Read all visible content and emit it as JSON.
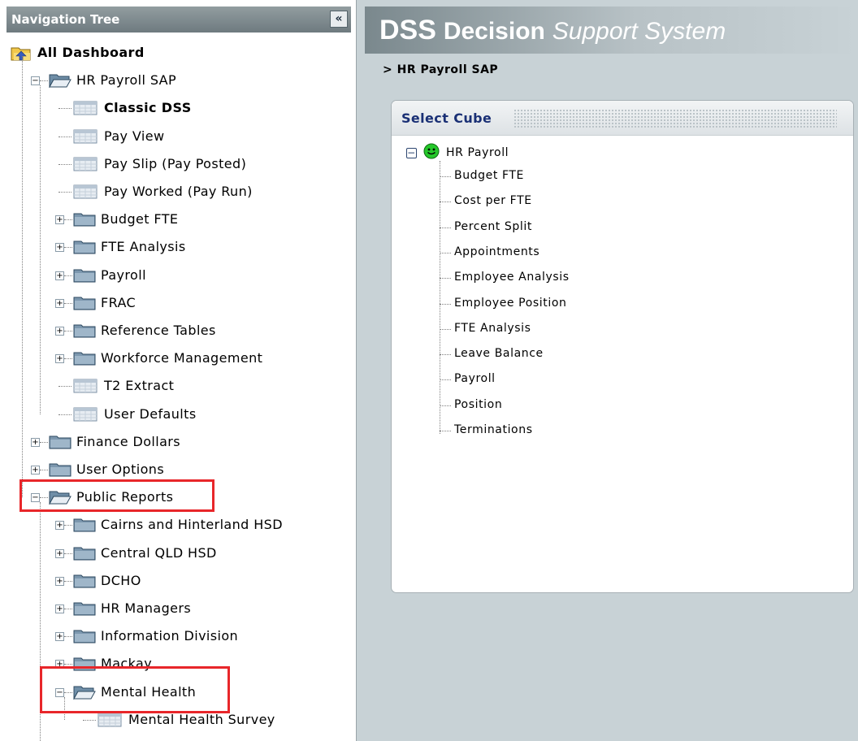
{
  "nav": {
    "title": "Navigation Tree",
    "collapse_glyph": "«",
    "items": [
      {
        "label": "All Dashboard",
        "icon": "dashboard-icon",
        "depth": 0,
        "toggle": "none",
        "bold": true
      },
      {
        "label": "HR Payroll SAP",
        "icon": "folder-open-icon",
        "depth": 1,
        "toggle": "minus",
        "bold": false
      },
      {
        "label": "Classic DSS",
        "icon": "report-icon",
        "depth": 2,
        "toggle": "none",
        "bold": true
      },
      {
        "label": "Pay View",
        "icon": "report-icon",
        "depth": 2,
        "toggle": "none",
        "bold": false
      },
      {
        "label": "Pay Slip (Pay Posted)",
        "icon": "report-icon",
        "depth": 2,
        "toggle": "none",
        "bold": false
      },
      {
        "label": "Pay Worked (Pay Run)",
        "icon": "report-icon",
        "depth": 2,
        "toggle": "none",
        "bold": false
      },
      {
        "label": "Budget FTE",
        "icon": "folder-icon",
        "depth": 2,
        "toggle": "plus",
        "bold": false
      },
      {
        "label": "FTE Analysis",
        "icon": "folder-icon",
        "depth": 2,
        "toggle": "plus",
        "bold": false
      },
      {
        "label": "Payroll",
        "icon": "folder-icon",
        "depth": 2,
        "toggle": "plus",
        "bold": false
      },
      {
        "label": "FRAC",
        "icon": "folder-icon",
        "depth": 2,
        "toggle": "plus",
        "bold": false
      },
      {
        "label": "Reference Tables",
        "icon": "folder-icon",
        "depth": 2,
        "toggle": "plus",
        "bold": false
      },
      {
        "label": "Workforce Management",
        "icon": "folder-icon",
        "depth": 2,
        "toggle": "plus",
        "bold": false
      },
      {
        "label": "T2 Extract",
        "icon": "report-icon",
        "depth": 2,
        "toggle": "none",
        "bold": false
      },
      {
        "label": "User Defaults",
        "icon": "report-icon",
        "depth": 2,
        "toggle": "none",
        "bold": false
      },
      {
        "label": "Finance Dollars",
        "icon": "folder-icon",
        "depth": 1,
        "toggle": "plus",
        "bold": false
      },
      {
        "label": "User Options",
        "icon": "folder-icon",
        "depth": 1,
        "toggle": "plus",
        "bold": false
      },
      {
        "label": "Public Reports",
        "icon": "folder-open-icon",
        "depth": 1,
        "toggle": "minus",
        "bold": false
      },
      {
        "label": "Cairns and Hinterland HSD",
        "icon": "folder-icon",
        "depth": 2,
        "toggle": "plus",
        "bold": false
      },
      {
        "label": "Central QLD HSD",
        "icon": "folder-icon",
        "depth": 2,
        "toggle": "plus",
        "bold": false
      },
      {
        "label": "DCHO",
        "icon": "folder-icon",
        "depth": 2,
        "toggle": "plus",
        "bold": false
      },
      {
        "label": "HR Managers",
        "icon": "folder-icon",
        "depth": 2,
        "toggle": "plus",
        "bold": false
      },
      {
        "label": "Information Division",
        "icon": "folder-icon",
        "depth": 2,
        "toggle": "plus",
        "bold": false
      },
      {
        "label": "Mackay",
        "icon": "folder-icon",
        "depth": 2,
        "toggle": "plus",
        "bold": false
      },
      {
        "label": "Mental Health",
        "icon": "folder-open-icon",
        "depth": 2,
        "toggle": "minus",
        "bold": false
      },
      {
        "label": "Mental Health Survey",
        "icon": "report-icon",
        "depth": 3,
        "toggle": "none",
        "bold": false
      },
      {
        "label": "",
        "icon": "folder-icon",
        "depth": 2,
        "toggle": "plus",
        "bold": false
      }
    ]
  },
  "banner": {
    "brand": "DSS",
    "word1": "Decision",
    "word2": "Support System"
  },
  "breadcrumb": "> HR Payroll SAP",
  "cube_panel": {
    "title": "Select Cube",
    "root": {
      "label": "HR Payroll",
      "toggle_glyph": "−",
      "status_icon": "smiley-icon"
    },
    "items": [
      "Budget FTE",
      "Cost per FTE",
      "Percent Split",
      "Appointments",
      "Employee Analysis",
      "Employee Position",
      "FTE Analysis",
      "Leave Balance",
      "Payroll",
      "Position",
      "Terminations"
    ]
  },
  "colors": {
    "highlight_box": "#e8262a",
    "cube_title": "#1a3075",
    "main_bg": "#c8d2d6"
  }
}
